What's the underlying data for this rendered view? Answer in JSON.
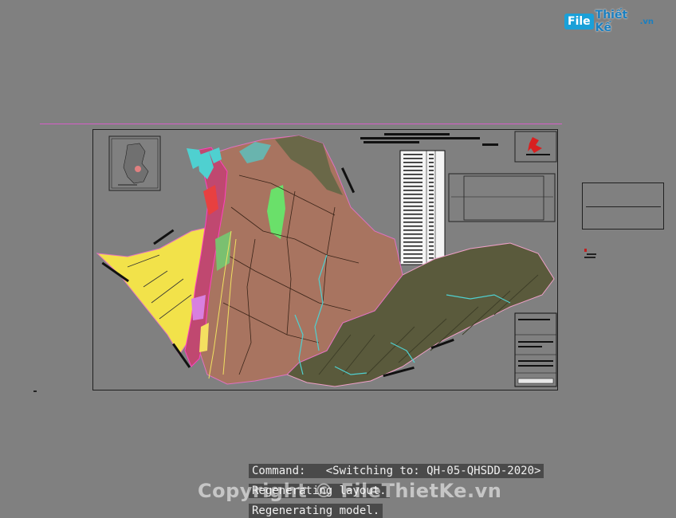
{
  "brand": {
    "logo_box": "File",
    "logo_text": "Thiết Kế",
    "logo_tld": ".vn"
  },
  "colors": {
    "background": "#808080",
    "terrain_brown": "#a87460",
    "terrain_dark": "#5a5a3c",
    "sand_yellow": "#f2e24a",
    "water_cyan": "#4fd0d0",
    "forest_green": "#6ae06a",
    "accent_magenta": "#d65ec9"
  },
  "command_line": {
    "line1": "Command:   <Switching to: QH-05-QHSDD-2020>",
    "line2": "Regenerating layout.",
    "line3": "Regenerating model."
  },
  "watermark": "Copyright © FileThietKe.vn"
}
